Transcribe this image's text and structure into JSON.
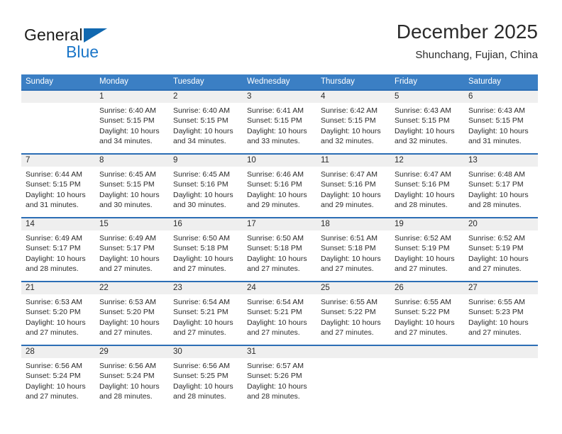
{
  "brand": {
    "name_part1": "General",
    "name_part2": "Blue",
    "triangle_color": "#1068b0",
    "blue_color": "#1b76c8"
  },
  "header": {
    "title": "December 2025",
    "subtitle": "Shunchang, Fujian, China"
  },
  "theme": {
    "header_blue": "#3b7fc4",
    "rule_blue": "#2c6eb5",
    "date_strip_gray": "#efefef",
    "text_color": "#2b2b2b"
  },
  "weekdays": [
    "Sunday",
    "Monday",
    "Tuesday",
    "Wednesday",
    "Thursday",
    "Friday",
    "Saturday"
  ],
  "weeks": [
    [
      {
        "blank": true,
        "day": "",
        "sunrise": "",
        "sunset": "",
        "daylight1": "",
        "daylight2": ""
      },
      {
        "blank": false,
        "day": "1",
        "sunrise": "Sunrise: 6:40 AM",
        "sunset": "Sunset: 5:15 PM",
        "daylight1": "Daylight: 10 hours",
        "daylight2": "and 34 minutes."
      },
      {
        "blank": false,
        "day": "2",
        "sunrise": "Sunrise: 6:40 AM",
        "sunset": "Sunset: 5:15 PM",
        "daylight1": "Daylight: 10 hours",
        "daylight2": "and 34 minutes."
      },
      {
        "blank": false,
        "day": "3",
        "sunrise": "Sunrise: 6:41 AM",
        "sunset": "Sunset: 5:15 PM",
        "daylight1": "Daylight: 10 hours",
        "daylight2": "and 33 minutes."
      },
      {
        "blank": false,
        "day": "4",
        "sunrise": "Sunrise: 6:42 AM",
        "sunset": "Sunset: 5:15 PM",
        "daylight1": "Daylight: 10 hours",
        "daylight2": "and 32 minutes."
      },
      {
        "blank": false,
        "day": "5",
        "sunrise": "Sunrise: 6:43 AM",
        "sunset": "Sunset: 5:15 PM",
        "daylight1": "Daylight: 10 hours",
        "daylight2": "and 32 minutes."
      },
      {
        "blank": false,
        "day": "6",
        "sunrise": "Sunrise: 6:43 AM",
        "sunset": "Sunset: 5:15 PM",
        "daylight1": "Daylight: 10 hours",
        "daylight2": "and 31 minutes."
      }
    ],
    [
      {
        "blank": false,
        "day": "7",
        "sunrise": "Sunrise: 6:44 AM",
        "sunset": "Sunset: 5:15 PM",
        "daylight1": "Daylight: 10 hours",
        "daylight2": "and 31 minutes."
      },
      {
        "blank": false,
        "day": "8",
        "sunrise": "Sunrise: 6:45 AM",
        "sunset": "Sunset: 5:15 PM",
        "daylight1": "Daylight: 10 hours",
        "daylight2": "and 30 minutes."
      },
      {
        "blank": false,
        "day": "9",
        "sunrise": "Sunrise: 6:45 AM",
        "sunset": "Sunset: 5:16 PM",
        "daylight1": "Daylight: 10 hours",
        "daylight2": "and 30 minutes."
      },
      {
        "blank": false,
        "day": "10",
        "sunrise": "Sunrise: 6:46 AM",
        "sunset": "Sunset: 5:16 PM",
        "daylight1": "Daylight: 10 hours",
        "daylight2": "and 29 minutes."
      },
      {
        "blank": false,
        "day": "11",
        "sunrise": "Sunrise: 6:47 AM",
        "sunset": "Sunset: 5:16 PM",
        "daylight1": "Daylight: 10 hours",
        "daylight2": "and 29 minutes."
      },
      {
        "blank": false,
        "day": "12",
        "sunrise": "Sunrise: 6:47 AM",
        "sunset": "Sunset: 5:16 PM",
        "daylight1": "Daylight: 10 hours",
        "daylight2": "and 28 minutes."
      },
      {
        "blank": false,
        "day": "13",
        "sunrise": "Sunrise: 6:48 AM",
        "sunset": "Sunset: 5:17 PM",
        "daylight1": "Daylight: 10 hours",
        "daylight2": "and 28 minutes."
      }
    ],
    [
      {
        "blank": false,
        "day": "14",
        "sunrise": "Sunrise: 6:49 AM",
        "sunset": "Sunset: 5:17 PM",
        "daylight1": "Daylight: 10 hours",
        "daylight2": "and 28 minutes."
      },
      {
        "blank": false,
        "day": "15",
        "sunrise": "Sunrise: 6:49 AM",
        "sunset": "Sunset: 5:17 PM",
        "daylight1": "Daylight: 10 hours",
        "daylight2": "and 27 minutes."
      },
      {
        "blank": false,
        "day": "16",
        "sunrise": "Sunrise: 6:50 AM",
        "sunset": "Sunset: 5:18 PM",
        "daylight1": "Daylight: 10 hours",
        "daylight2": "and 27 minutes."
      },
      {
        "blank": false,
        "day": "17",
        "sunrise": "Sunrise: 6:50 AM",
        "sunset": "Sunset: 5:18 PM",
        "daylight1": "Daylight: 10 hours",
        "daylight2": "and 27 minutes."
      },
      {
        "blank": false,
        "day": "18",
        "sunrise": "Sunrise: 6:51 AM",
        "sunset": "Sunset: 5:18 PM",
        "daylight1": "Daylight: 10 hours",
        "daylight2": "and 27 minutes."
      },
      {
        "blank": false,
        "day": "19",
        "sunrise": "Sunrise: 6:52 AM",
        "sunset": "Sunset: 5:19 PM",
        "daylight1": "Daylight: 10 hours",
        "daylight2": "and 27 minutes."
      },
      {
        "blank": false,
        "day": "20",
        "sunrise": "Sunrise: 6:52 AM",
        "sunset": "Sunset: 5:19 PM",
        "daylight1": "Daylight: 10 hours",
        "daylight2": "and 27 minutes."
      }
    ],
    [
      {
        "blank": false,
        "day": "21",
        "sunrise": "Sunrise: 6:53 AM",
        "sunset": "Sunset: 5:20 PM",
        "daylight1": "Daylight: 10 hours",
        "daylight2": "and 27 minutes."
      },
      {
        "blank": false,
        "day": "22",
        "sunrise": "Sunrise: 6:53 AM",
        "sunset": "Sunset: 5:20 PM",
        "daylight1": "Daylight: 10 hours",
        "daylight2": "and 27 minutes."
      },
      {
        "blank": false,
        "day": "23",
        "sunrise": "Sunrise: 6:54 AM",
        "sunset": "Sunset: 5:21 PM",
        "daylight1": "Daylight: 10 hours",
        "daylight2": "and 27 minutes."
      },
      {
        "blank": false,
        "day": "24",
        "sunrise": "Sunrise: 6:54 AM",
        "sunset": "Sunset: 5:21 PM",
        "daylight1": "Daylight: 10 hours",
        "daylight2": "and 27 minutes."
      },
      {
        "blank": false,
        "day": "25",
        "sunrise": "Sunrise: 6:55 AM",
        "sunset": "Sunset: 5:22 PM",
        "daylight1": "Daylight: 10 hours",
        "daylight2": "and 27 minutes."
      },
      {
        "blank": false,
        "day": "26",
        "sunrise": "Sunrise: 6:55 AM",
        "sunset": "Sunset: 5:22 PM",
        "daylight1": "Daylight: 10 hours",
        "daylight2": "and 27 minutes."
      },
      {
        "blank": false,
        "day": "27",
        "sunrise": "Sunrise: 6:55 AM",
        "sunset": "Sunset: 5:23 PM",
        "daylight1": "Daylight: 10 hours",
        "daylight2": "and 27 minutes."
      }
    ],
    [
      {
        "blank": false,
        "day": "28",
        "sunrise": "Sunrise: 6:56 AM",
        "sunset": "Sunset: 5:24 PM",
        "daylight1": "Daylight: 10 hours",
        "daylight2": "and 27 minutes."
      },
      {
        "blank": false,
        "day": "29",
        "sunrise": "Sunrise: 6:56 AM",
        "sunset": "Sunset: 5:24 PM",
        "daylight1": "Daylight: 10 hours",
        "daylight2": "and 28 minutes."
      },
      {
        "blank": false,
        "day": "30",
        "sunrise": "Sunrise: 6:56 AM",
        "sunset": "Sunset: 5:25 PM",
        "daylight1": "Daylight: 10 hours",
        "daylight2": "and 28 minutes."
      },
      {
        "blank": false,
        "day": "31",
        "sunrise": "Sunrise: 6:57 AM",
        "sunset": "Sunset: 5:26 PM",
        "daylight1": "Daylight: 10 hours",
        "daylight2": "and 28 minutes."
      },
      {
        "blank": true,
        "day": "",
        "sunrise": "",
        "sunset": "",
        "daylight1": "",
        "daylight2": ""
      },
      {
        "blank": true,
        "day": "",
        "sunrise": "",
        "sunset": "",
        "daylight1": "",
        "daylight2": ""
      },
      {
        "blank": true,
        "day": "",
        "sunrise": "",
        "sunset": "",
        "daylight1": "",
        "daylight2": ""
      }
    ]
  ]
}
